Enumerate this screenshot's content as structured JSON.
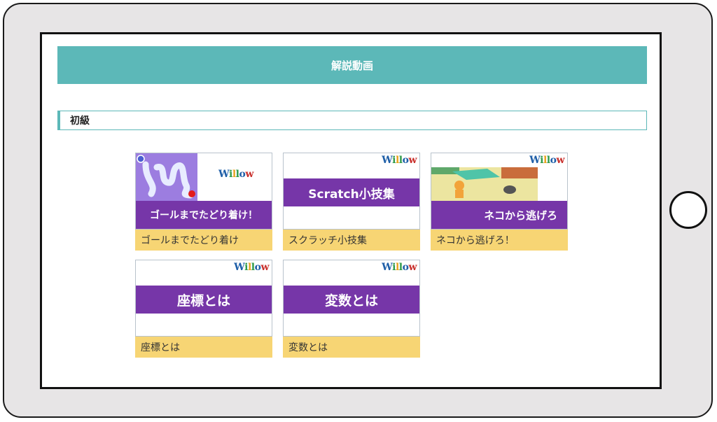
{
  "header": {
    "title": "解説動画"
  },
  "section": {
    "title": "初級"
  },
  "brand": {
    "logo_text": "Willow",
    "accent": "#7636a8",
    "teal": "#5cb8b8",
    "caption_bg": "#f7d574"
  },
  "videos": [
    {
      "thumb_title": "ゴールまでたどり着け！",
      "caption": "ゴールまでたどり着け"
    },
    {
      "thumb_title": "Scratch小技集",
      "caption": "スクラッチ小技集"
    },
    {
      "thumb_title": "ネコから逃げろ",
      "caption": "ネコから逃げろ！"
    },
    {
      "thumb_title": "座標とは",
      "caption": "座標とは"
    },
    {
      "thumb_title": "変数とは",
      "caption": "変数とは"
    }
  ]
}
